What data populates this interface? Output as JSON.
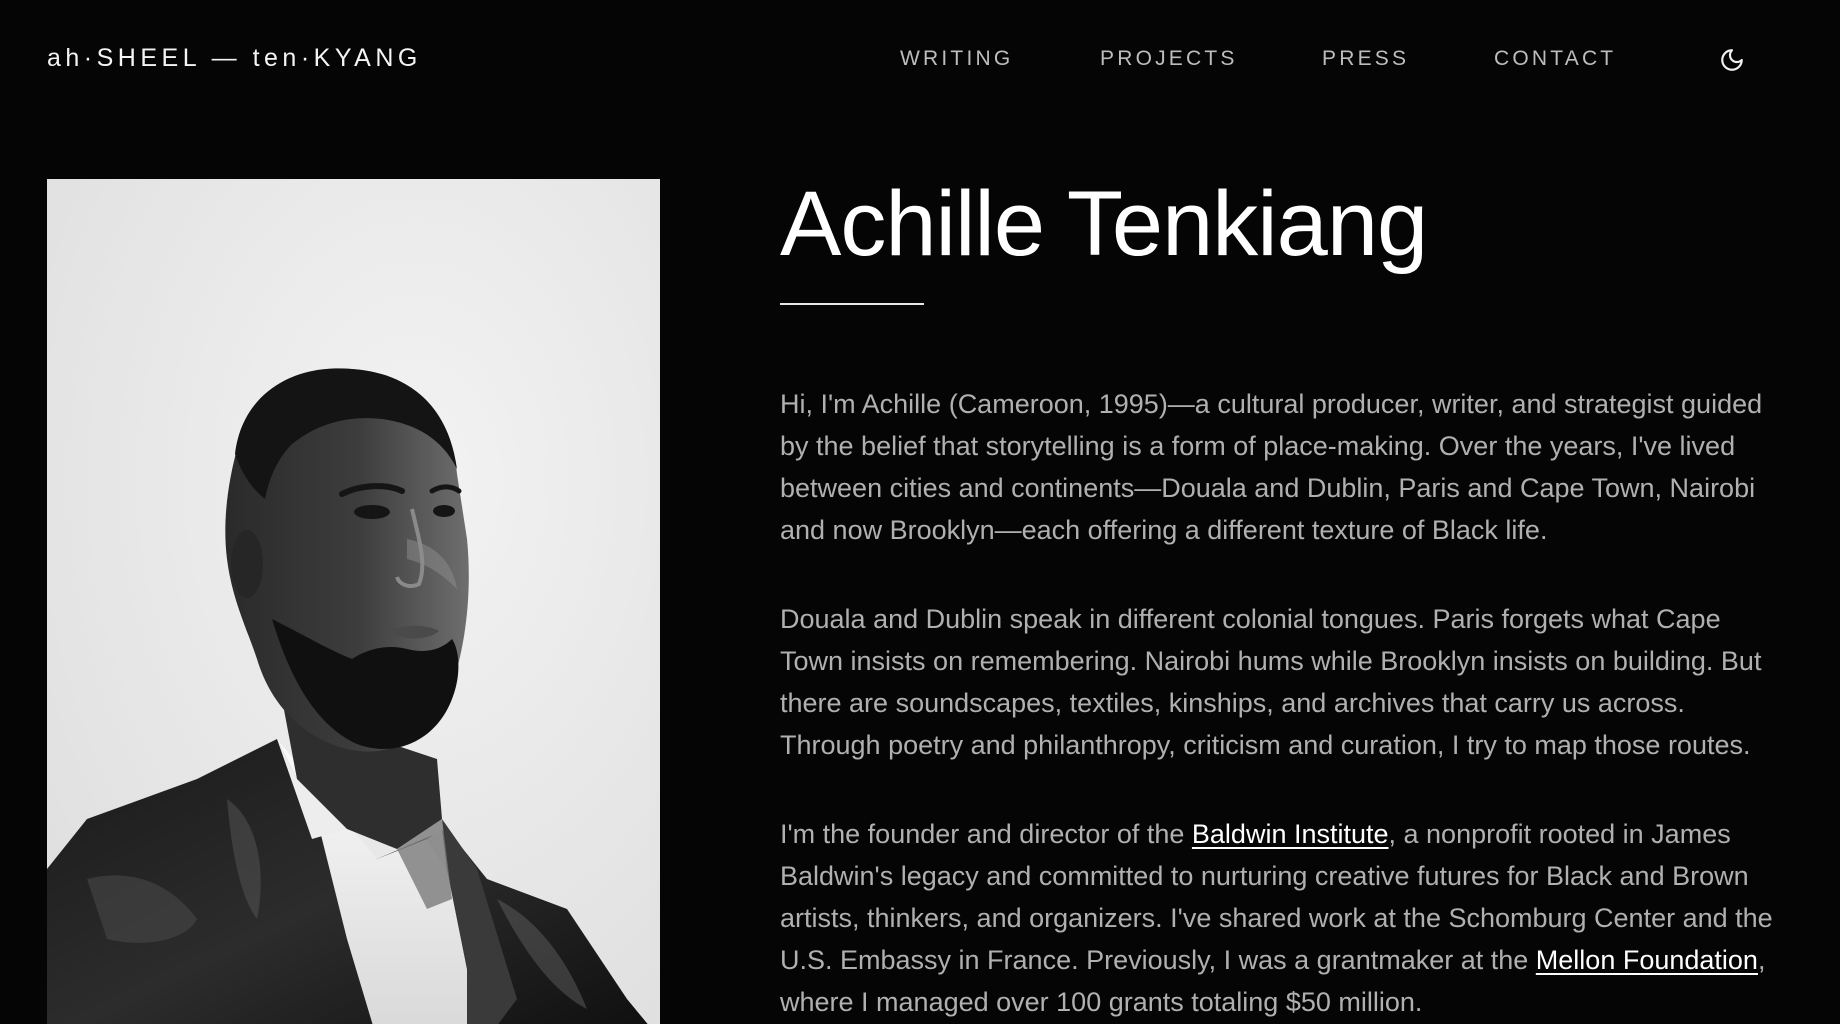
{
  "header": {
    "wordmark": "ah·SHEEL — ten·KYANG",
    "nav": {
      "writing": "WRITING",
      "projects": "PROJECTS",
      "press": "PRESS",
      "contact": "CONTACT"
    },
    "theme_toggle_icon": "moon-icon"
  },
  "hero": {
    "name": "Achille Tenkiang",
    "portrait_icon": "portrait-photo"
  },
  "bio": {
    "p1": "Hi, I'm Achille (Cameroon, 1995)—a cultural producer, writer, and strategist guided by the belief that storytelling is a form of place-making. Over the years, I've lived between cities and continents—Douala and Dublin, Paris and Cape Town, Nairobi and now Brooklyn—each offering a different texture of Black life.",
    "p2": "Douala and Dublin speak in different colonial tongues. Paris forgets what Cape Town insists on remembering. Nairobi hums while Brooklyn insists on building. But there are soundscapes, textiles, kinships, and archives that carry us across. Through poetry and philanthropy, criticism and curation, I try to map those routes.",
    "p3_before": "I'm the founder and director of the ",
    "p3_link": "Baldwin Institute",
    "p3_after": ", a nonprofit rooted in James Baldwin's legacy and committed to nurturing creative futures for Black and Brown artists, thinkers, and organizers. I've shared work at the Schomburg Center and the U.S. Embassy in France. Previously, I was a grantmaker at the ",
    "p3_link2": "Mellon Foundation",
    "p3_end": ", where I managed over 100 grants totaling $50 million."
  },
  "colors": {
    "background": "#050506",
    "text_primary": "#ffffff",
    "text_body": "#b0b0b0",
    "nav": "#bdbdbd"
  }
}
